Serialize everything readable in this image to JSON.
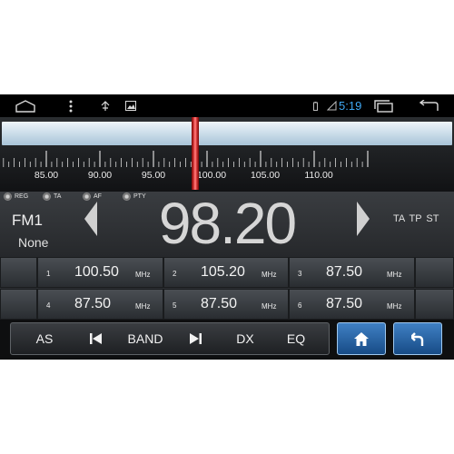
{
  "status_bar": {
    "time": "5:19",
    "icons": [
      "home-outline-icon",
      "overflow-menu-icon",
      "usb-icon",
      "image-icon",
      "battery-icon",
      "signal-icon",
      "recent-apps-icon",
      "back-arrow-icon"
    ]
  },
  "tuner": {
    "scale": [
      {
        "label": "85.00",
        "mhz": 85.0
      },
      {
        "label": "90.00",
        "mhz": 90.0
      },
      {
        "label": "95.00",
        "mhz": 95.0
      },
      {
        "label": "100.00",
        "mhz": 100.0
      },
      {
        "label": "105.00",
        "mhz": 105.0
      },
      {
        "label": "110.00",
        "mhz": 110.0
      }
    ],
    "needle_mhz": 98.2
  },
  "display": {
    "flags": [
      "REG",
      "TA",
      "AF",
      "PTY"
    ],
    "band": "FM1",
    "ps_name": "None",
    "frequency": "98.20",
    "rds_flags": "TA TP ST"
  },
  "presets": [
    {
      "num": "1",
      "freq": "100.50",
      "unit": "MHz"
    },
    {
      "num": "2",
      "freq": "105.20",
      "unit": "MHz"
    },
    {
      "num": "3",
      "freq": "87.50",
      "unit": "MHz"
    },
    {
      "num": "4",
      "freq": "87.50",
      "unit": "MHz"
    },
    {
      "num": "5",
      "freq": "87.50",
      "unit": "MHz"
    },
    {
      "num": "6",
      "freq": "87.50",
      "unit": "MHz"
    }
  ],
  "controls": {
    "as": "AS",
    "band": "BAND",
    "dx": "DX",
    "eq": "EQ"
  },
  "colors": {
    "accent_blue": "#3fa9f5",
    "button_blue": "#2a67a8",
    "needle_red": "#e02020"
  }
}
